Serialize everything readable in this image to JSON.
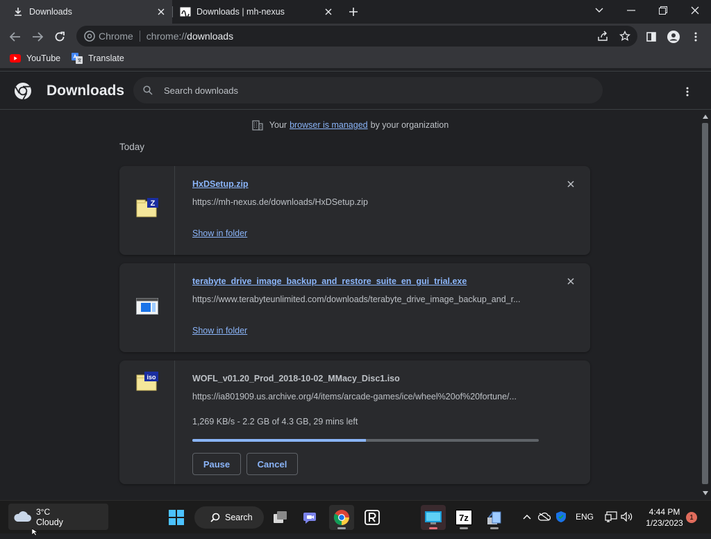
{
  "browser": {
    "tabs": [
      {
        "title": "Downloads",
        "icon": "download-icon",
        "active": true
      },
      {
        "title": "Downloads | mh-nexus",
        "icon": "mh-nexus-favicon",
        "active": false
      }
    ],
    "address": {
      "site_label": "Chrome",
      "scheme": "chrome://",
      "host": "downloads"
    },
    "bookmarks": [
      {
        "label": "YouTube",
        "icon": "youtube-icon"
      },
      {
        "label": "Translate",
        "icon": "translate-icon"
      }
    ]
  },
  "downloads_page": {
    "title": "Downloads",
    "search_placeholder": "Search downloads",
    "managed_notice": {
      "before": "Your",
      "link": "browser is managed",
      "after": "by your organization"
    },
    "date_header": "Today",
    "items": [
      {
        "file_name": "HxDSetup.zip",
        "url": "https://mh-nexus.de/downloads/HxDSetup.zip",
        "action": "Show in folder",
        "icon": "zip-archive-icon"
      },
      {
        "file_name": "terabyte_drive_image_backup_and_restore_suite_en_gui_trial.exe",
        "url": "https://www.terabyteunlimited.com/downloads/terabyte_drive_image_backup_and_r...",
        "action": "Show in folder",
        "icon": "executable-icon"
      },
      {
        "file_name": "WOFL_v01.20_Prod_2018-10-02_MMacy_Disc1.iso",
        "url": "https://ia801909.us.archive.org/4/items/arcade-games/ice/wheel%20of%20fortune/...",
        "status": "1,269 KB/s - 2.2 GB of 4.3 GB, 29 mins left",
        "progress_fraction": 0.5,
        "pause_label": "Pause",
        "cancel_label": "Cancel",
        "icon": "iso-image-icon"
      }
    ]
  },
  "taskbar": {
    "weather": {
      "temperature": "3°C",
      "condition": "Cloudy"
    },
    "search_label": "Search",
    "language": "ENG",
    "time": "4:44 PM",
    "date": "1/23/2023",
    "notification_count": "1"
  },
  "colors": {
    "accent": "#8ab4f8",
    "page_bg": "#202124",
    "card_bg": "#292a2d"
  }
}
